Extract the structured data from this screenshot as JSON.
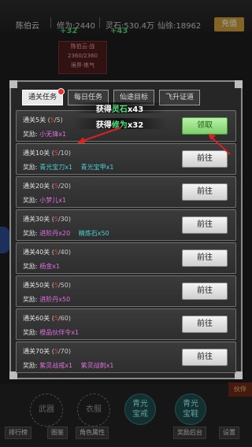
{
  "topbar": {
    "name": "陈伯云",
    "cultivation": "修为:2440",
    "spirit_stone": "灵石:530.4万",
    "immortal_value": "仙徐:18962",
    "gain_left": "+32",
    "gain_right": "+43",
    "charge_label": "充值"
  },
  "background_player": {
    "name": "陈伯云·战",
    "hp": "2360/2360",
    "status": "境界·练气"
  },
  "tabs": [
    {
      "label": "通关任务",
      "badge": true
    },
    {
      "label": "每日任务"
    },
    {
      "label": "仙途目标"
    },
    {
      "label": "飞升证道"
    }
  ],
  "float_messages": [
    {
      "prefix": "获得",
      "highlight": "灵石",
      "suffix": "x43"
    },
    {
      "prefix": "获得",
      "highlight": "修为",
      "suffix": "x32"
    }
  ],
  "reward_label": "奖励:",
  "tasks": [
    {
      "title": "通关5关",
      "cur": "5",
      "total": "/5",
      "rewards": [
        {
          "name": "小无锋x1",
          "color": "#e070e0"
        }
      ],
      "button": "领取",
      "claim": true
    },
    {
      "title": "通关10关",
      "cur": "5",
      "total": "/10",
      "rewards": [
        {
          "name": "青光宝刀x1",
          "color": "#49d1d1"
        },
        {
          "name": "青光宝甲x1",
          "color": "#49d1d1"
        }
      ],
      "button": "前往"
    },
    {
      "title": "通关20关",
      "cur": "5",
      "total": "/20",
      "rewards": [
        {
          "name": "小梦儿x1",
          "color": "#e070e0"
        }
      ],
      "button": "前往"
    },
    {
      "title": "通关30关",
      "cur": "5",
      "total": "/30",
      "rewards": [
        {
          "name": "进阶丹x20",
          "color": "#e070e0"
        },
        {
          "name": "精炼石x50",
          "color": "#49d1d1"
        }
      ],
      "button": "前往"
    },
    {
      "title": "通关40关",
      "cur": "5",
      "total": "/40",
      "rewards": [
        {
          "name": "杨金x1",
          "color": "#e070e0"
        }
      ],
      "button": "前往"
    },
    {
      "title": "通关50关",
      "cur": "5",
      "total": "/50",
      "rewards": [
        {
          "name": "进阶丹x50",
          "color": "#e070e0"
        }
      ],
      "button": "前往"
    },
    {
      "title": "通关60关",
      "cur": "5",
      "total": "/60",
      "rewards": [
        {
          "name": "橙品伙伴令x1",
          "color": "#e070e0"
        }
      ],
      "button": "前往"
    },
    {
      "title": "通关70关",
      "cur": "5",
      "total": "/70",
      "rewards": [
        {
          "name": "紫灵战戒x1",
          "color": "#e070e0"
        },
        {
          "name": "紫灵战刺x1",
          "color": "#e070e0"
        }
      ],
      "button": "前往"
    }
  ],
  "bottom": {
    "slots": [
      "武器",
      "衣服",
      "青光\n宝戒",
      "青光\n宝鞋"
    ],
    "nav": [
      "排行榜",
      "图鉴",
      "角色属性",
      "奖励后台",
      "设置"
    ],
    "side_right": "伙伴"
  },
  "colors": {
    "accent": "#4fe07a",
    "danger": "#e23030",
    "claim": "#7ccf6a"
  }
}
